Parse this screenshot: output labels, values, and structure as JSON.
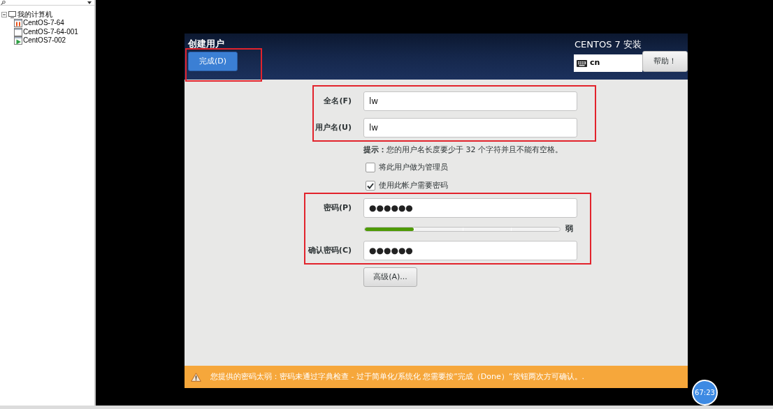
{
  "sidebar": {
    "tree": [
      {
        "label": "我的计算机",
        "expanded": true,
        "children": [
          {
            "label": "CentOS-7-64",
            "kind": "paused"
          },
          {
            "label": "CentOS-7-64-001",
            "kind": "stopped"
          },
          {
            "label": "CentOS7-002",
            "kind": "running"
          }
        ]
      }
    ]
  },
  "installer": {
    "title": "创建用户",
    "done_button": "完成(D)",
    "product": "CENTOS 7 安装",
    "keyboard_layout": "cn",
    "help_button": "帮助！",
    "fields": [
      {
        "label": "全名(F)",
        "value": "lw"
      },
      {
        "label": "用户名(U)",
        "value": "lw"
      }
    ],
    "hint": "**提示：**您的用户名长度要少于 32 个字符并且不能有空格。",
    "options": [
      {
        "label": "将此用户做为管理员",
        "checked": false
      },
      {
        "label": "使用此帐户需要密码",
        "checked": true
      }
    ],
    "password": {
      "label": "密码(P)",
      "value": "●●●●●●"
    },
    "password_strength": {
      "level": 0.25,
      "reading": "弱"
    },
    "confirm_password": {
      "label": "确认密码(C)",
      "value": "●●●●●●"
    },
    "advanced_button": "高级(A)...",
    "warning": "您提供的密码太弱：密码未通过字典检查 - 过于简单化/系统化 您需要按”完成（Done）”按钮两次方可确认。."
  },
  "timer_badge": "67:23"
}
